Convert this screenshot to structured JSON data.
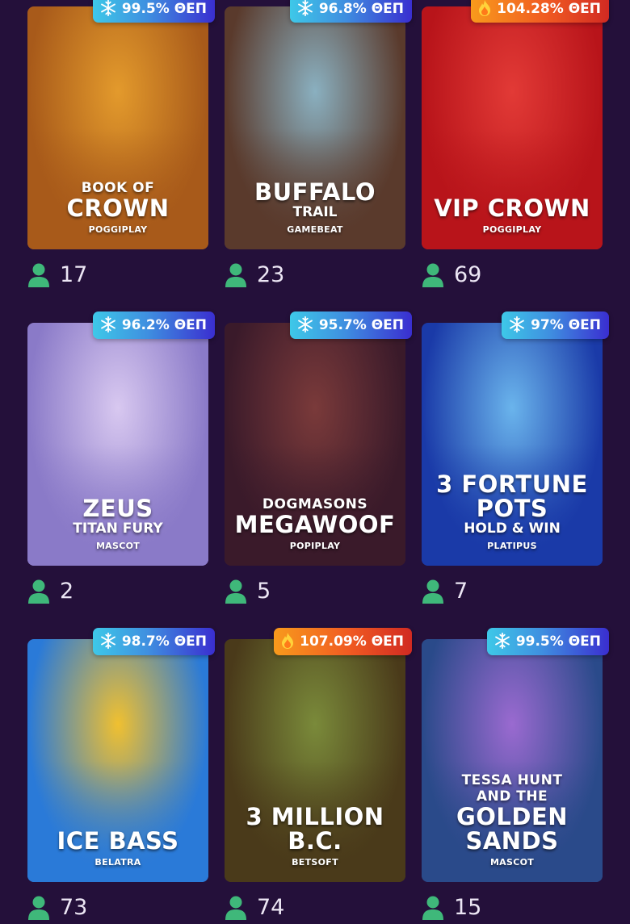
{
  "games": [
    {
      "title_lines": [
        {
          "text": "BOOK OF",
          "size": "small"
        },
        {
          "text": "CROWN",
          "size": "big"
        }
      ],
      "provider": "POGGIPLAY",
      "rtp": "99.5% ΘΕΠ",
      "badge_type": "cool",
      "badge_icon": "snowflake-icon",
      "players": "17",
      "bg": "#a85a1a",
      "bg_hi": "#e39a2c"
    },
    {
      "title_lines": [
        {
          "text": "BUFFALO",
          "size": "big"
        },
        {
          "text": "TRAIL",
          "size": "mid"
        }
      ],
      "provider": "GAMEBEAT",
      "rtp": "96.8% ΘΕΠ",
      "badge_type": "cool",
      "badge_icon": "snowflake-icon",
      "players": "23",
      "bg": "#5a3a2c",
      "bg_hi": "#8ab0c0"
    },
    {
      "title_lines": [
        {
          "text": "VIP CROWN",
          "size": "big"
        }
      ],
      "provider": "POGGIPLAY",
      "rtp": "104.28% ΘΕΠ",
      "badge_type": "hot",
      "badge_icon": "flame-icon",
      "players": "69",
      "bg": "#b8141a",
      "bg_hi": "#e23a36"
    },
    {
      "title_lines": [
        {
          "text": "ZEUS",
          "size": "big"
        },
        {
          "text": "TITAN FURY",
          "size": "mid"
        }
      ],
      "provider": "MASCOT",
      "rtp": "96.2% ΘΕΠ",
      "badge_type": "cool",
      "badge_icon": "snowflake-icon",
      "players": "2",
      "bg": "#8a7ac8",
      "bg_hi": "#d8c8f0"
    },
    {
      "title_lines": [
        {
          "text": "DOGMASONS",
          "size": "small"
        },
        {
          "text": "MEGAWOOF",
          "size": "big"
        }
      ],
      "provider": "POPIPLAY",
      "rtp": "95.7% ΘΕΠ",
      "badge_type": "cool",
      "badge_icon": "snowflake-icon",
      "players": "5",
      "bg": "#3a1a2a",
      "bg_hi": "#7a3a3a"
    },
    {
      "title_lines": [
        {
          "text": "3 FORTUNE",
          "size": "big"
        },
        {
          "text": "POTS",
          "size": "big"
        },
        {
          "text": "HOLD & WIN",
          "size": "mid"
        }
      ],
      "provider": "PLATIPUS",
      "rtp": "97% ΘΕΠ",
      "badge_type": "cool",
      "badge_icon": "snowflake-icon",
      "players": "7",
      "bg": "#1a3aa8",
      "bg_hi": "#6ab4ec"
    },
    {
      "title_lines": [
        {
          "text": "ICE BASS",
          "size": "big"
        }
      ],
      "provider": "BELATRA",
      "rtp": "98.7% ΘΕΠ",
      "badge_type": "cool",
      "badge_icon": "snowflake-icon",
      "players": "73",
      "bg": "#2a7ad8",
      "bg_hi": "#f0c030"
    },
    {
      "title_lines": [
        {
          "text": "3 MILLION B.C.",
          "size": "big"
        }
      ],
      "provider": "BETSOFT",
      "rtp": "107.09% ΘΕΠ",
      "badge_type": "hot",
      "badge_icon": "flame-icon",
      "players": "74",
      "bg": "#4a3a1a",
      "bg_hi": "#7a8a3a"
    },
    {
      "title_lines": [
        {
          "text": "TESSA HUNT",
          "size": "small"
        },
        {
          "text": "AND THE",
          "size": "small"
        },
        {
          "text": "GOLDEN",
          "size": "big"
        },
        {
          "text": "SANDS",
          "size": "big"
        }
      ],
      "provider": "MASCOT",
      "rtp": "99.5% ΘΕΠ",
      "badge_type": "cool",
      "badge_icon": "snowflake-icon",
      "players": "15",
      "bg": "#2a4a8a",
      "bg_hi": "#9a6ad0"
    }
  ],
  "colors": {
    "page_bg": "#24103a",
    "player_icon": "#3fb87a",
    "count_text": "#ece6f4"
  }
}
